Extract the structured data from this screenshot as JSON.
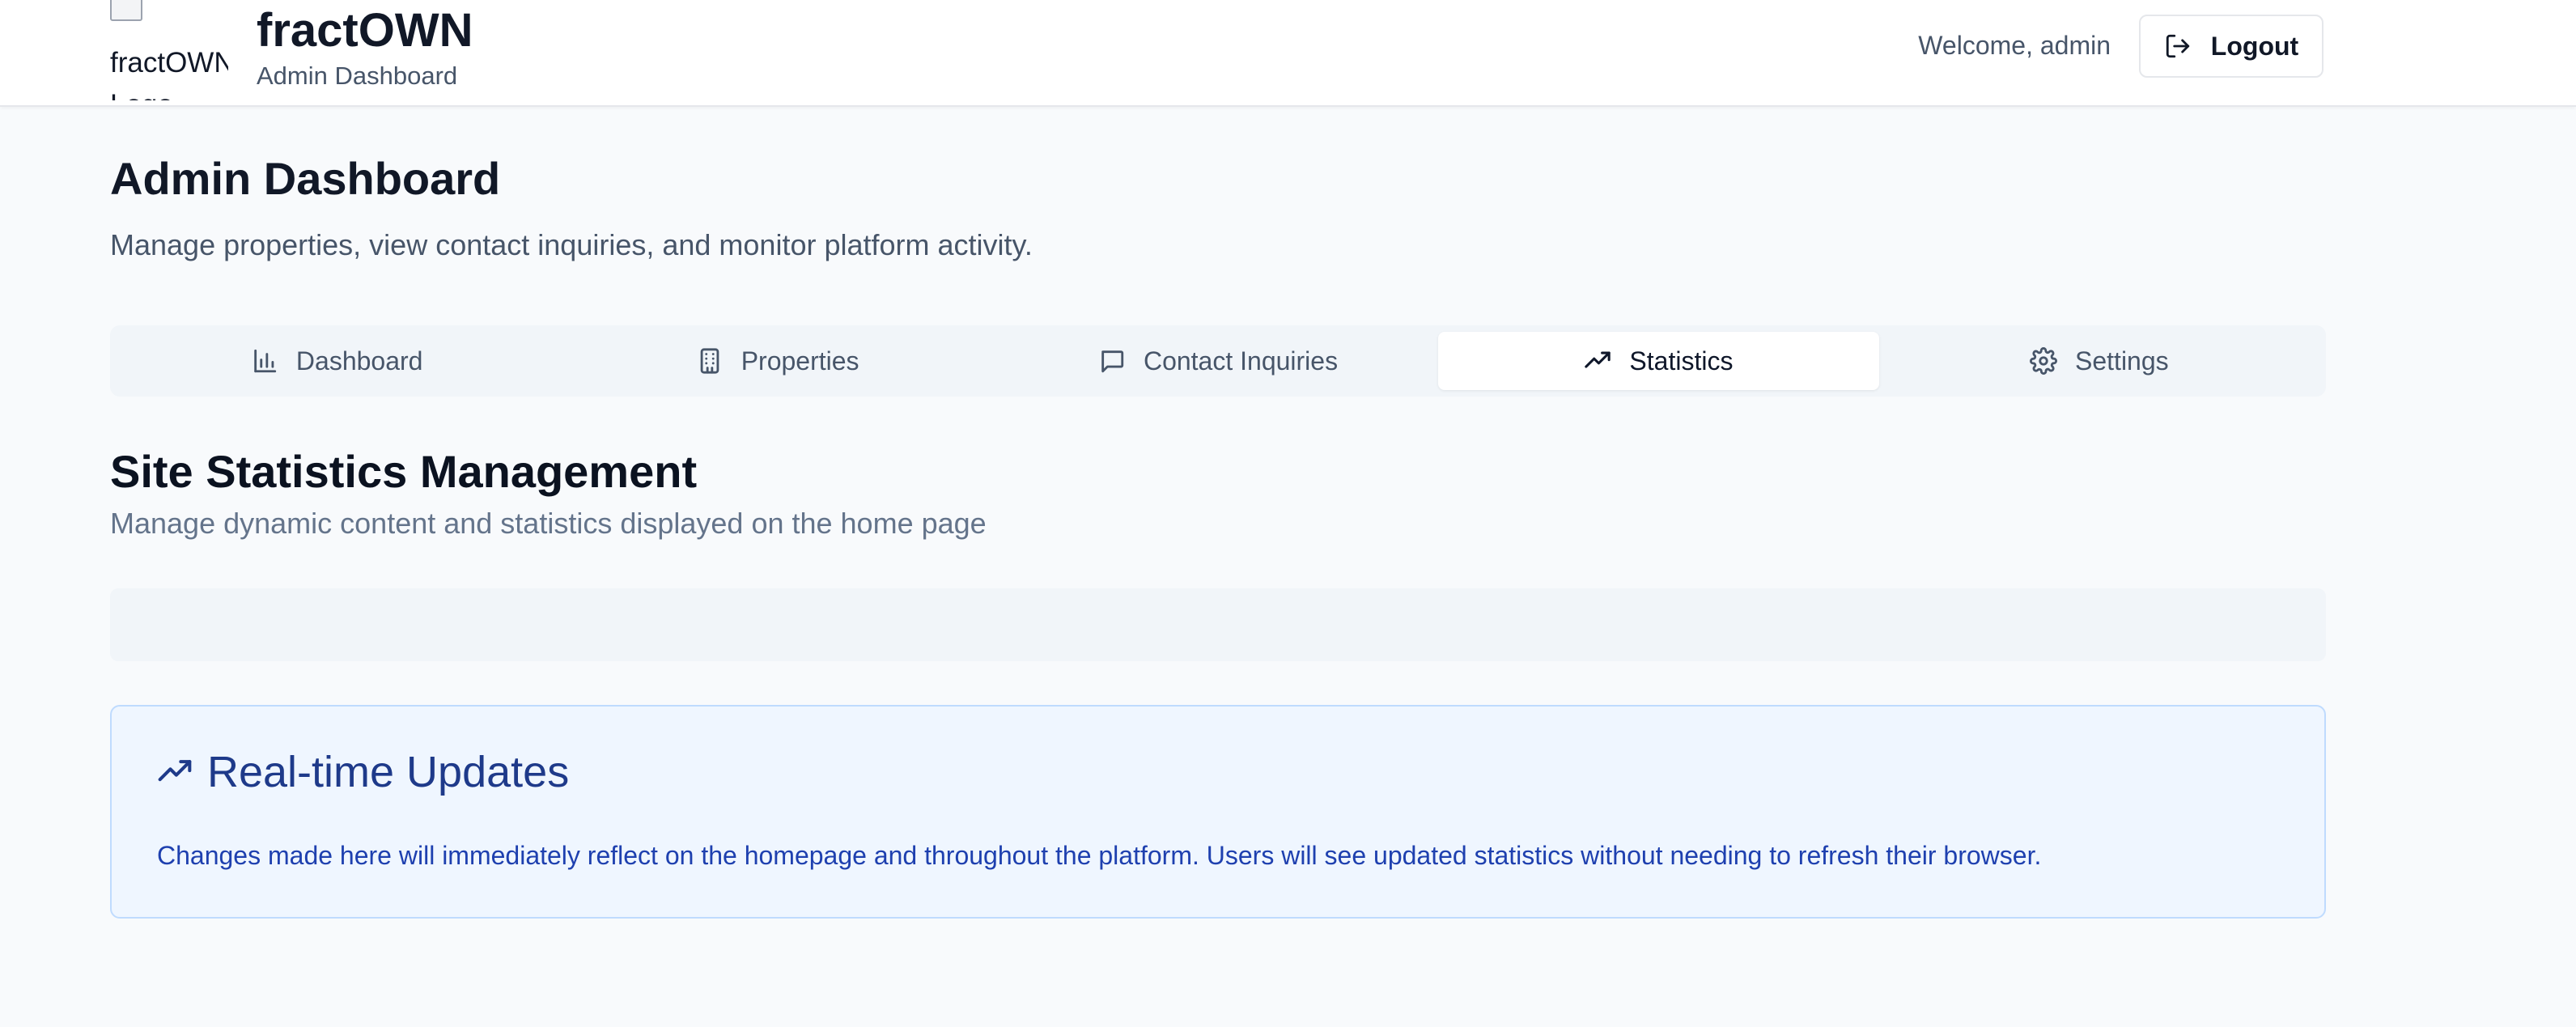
{
  "header": {
    "logo_alt": "fractOWN Logo",
    "brand_title": "fractOWN",
    "brand_subtitle": "Admin Dashboard",
    "welcome": "Welcome, admin",
    "logout_label": "Logout"
  },
  "page": {
    "title": "Admin Dashboard",
    "description": "Manage properties, view contact inquiries, and monitor platform activity."
  },
  "tabs": [
    {
      "label": "Dashboard",
      "icon": "bar-chart-icon",
      "active": false
    },
    {
      "label": "Properties",
      "icon": "building-icon",
      "active": false
    },
    {
      "label": "Contact Inquiries",
      "icon": "message-icon",
      "active": false
    },
    {
      "label": "Statistics",
      "icon": "trending-up-icon",
      "active": true
    },
    {
      "label": "Settings",
      "icon": "gear-icon",
      "active": false
    }
  ],
  "section": {
    "title": "Site Statistics Management",
    "description": "Manage dynamic content and statistics displayed on the home page"
  },
  "info": {
    "title": "Real-time Updates",
    "text": "Changes made here will immediately reflect on the homepage and throughout the platform. Users will see updated statistics without needing to refresh their browser."
  },
  "colors": {
    "accent_blue": "#1e3a8a",
    "info_bg": "#eff6ff",
    "info_border": "#bfdbfe"
  }
}
